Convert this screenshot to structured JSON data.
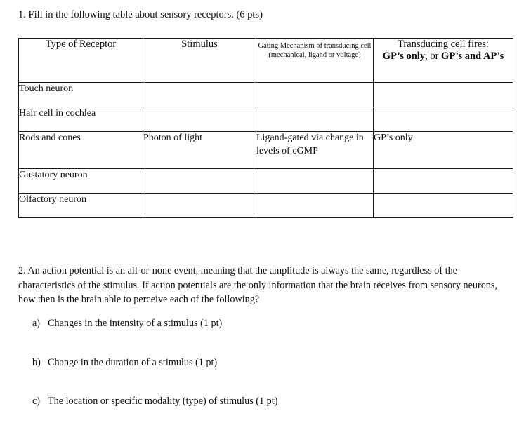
{
  "document": {
    "question1": {
      "text": "1. Fill in the following table about sensory receptors. (6 pts)"
    },
    "table": {
      "headers": {
        "col1": "Type of Receptor",
        "col2": "Stimulus",
        "col3": "Gating Mechanism of transducing cell (mechanical, ligand or voltage)",
        "col4_line1": "Transducing cell fires:",
        "col4_option1": "GP’s only",
        "col4_conjunction": ", or ",
        "col4_option2": "GP’s and AP’s"
      },
      "rows": [
        {
          "receptor": "Touch neuron",
          "stimulus": "",
          "gating": "",
          "fires": ""
        },
        {
          "receptor": "Hair cell in cochlea",
          "stimulus": "",
          "gating": "",
          "fires": ""
        },
        {
          "receptor": "Rods and cones",
          "stimulus": "Photon of light",
          "gating": "Ligand-gated via change in levels of cGMP",
          "fires": "GP’s only"
        },
        {
          "receptor": "Gustatory neuron",
          "stimulus": "",
          "gating": "",
          "fires": ""
        },
        {
          "receptor": "Olfactory neuron",
          "stimulus": "",
          "gating": "",
          "fires": ""
        }
      ]
    },
    "question2": {
      "text": "2. An action potential is an all-or-none event, meaning that the amplitude is always the same, regardless of the characteristics of the stimulus. If action potentials are the only information that the brain receives from sensory neurons, how then is the brain able to perceive each of the following?",
      "items": [
        {
          "marker": "a)",
          "text": "Changes in the intensity of a stimulus (1 pt)"
        },
        {
          "marker": "b)",
          "text": "Change in the duration of a stimulus (1 pt)"
        },
        {
          "marker": "c)",
          "text": "The location or specific modality (type) of stimulus (1 pt)"
        }
      ]
    }
  }
}
